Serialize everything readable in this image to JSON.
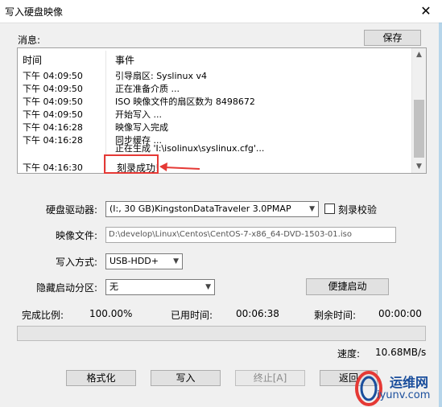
{
  "window": {
    "title": "写入硬盘映像",
    "close_glyph": "✕"
  },
  "message_label": "消息:",
  "save_button": "保存",
  "log": {
    "columns": [
      "时间",
      "事件"
    ],
    "rows": [
      {
        "time": "下午 04:09:50",
        "event": "引导扇区: Syslinux v4"
      },
      {
        "time": "下午 04:09:50",
        "event": "正在准备介质 ..."
      },
      {
        "time": "下午 04:09:50",
        "event": "ISO 映像文件的扇区数为 8498672"
      },
      {
        "time": "下午 04:09:50",
        "event": "开始写入 ..."
      },
      {
        "time": "下午 04:16:28",
        "event": "映像写入完成"
      },
      {
        "time": "下午 04:16:28",
        "event": "同步缓存 ..."
      },
      {
        "time": "",
        "event": "正在生成 'I:\\isolinux\\syslinux.cfg'..."
      },
      {
        "time": "下午 04:16:30",
        "event": "刻录成功!"
      }
    ]
  },
  "form": {
    "drive_label": "硬盘驱动器:",
    "drive_value": "(I:, 30 GB)KingstonDataTraveler 3.0PMAP",
    "verify_label": "刻录校验",
    "image_label": "映像文件:",
    "image_value": "D:\\develop\\Linux\\Centos\\CentOS-7-x86_64-DVD-1503-01.iso",
    "method_label": "写入方式:",
    "method_value": "USB-HDD+",
    "hidden_label": "隐藏启动分区:",
    "hidden_value": "无",
    "quickboot_button": "便捷启动"
  },
  "stats": {
    "done_label": "完成比例:",
    "done_value": "100.00%",
    "elapsed_label": "已用时间:",
    "elapsed_value": "00:06:38",
    "remaining_label": "剩余时间:",
    "remaining_value": "00:00:00",
    "progress_percent": 100,
    "speed_label": "速度:",
    "speed_value": "10.68MB/s"
  },
  "buttons": {
    "format": "格式化",
    "write": "写入",
    "stop": "终止[A]",
    "back": "返回"
  },
  "watermark": {
    "brand": "运维网",
    "url": "iyunv.com"
  },
  "colors": {
    "highlight": "#e53935",
    "watermark": "#1a4e9c"
  }
}
